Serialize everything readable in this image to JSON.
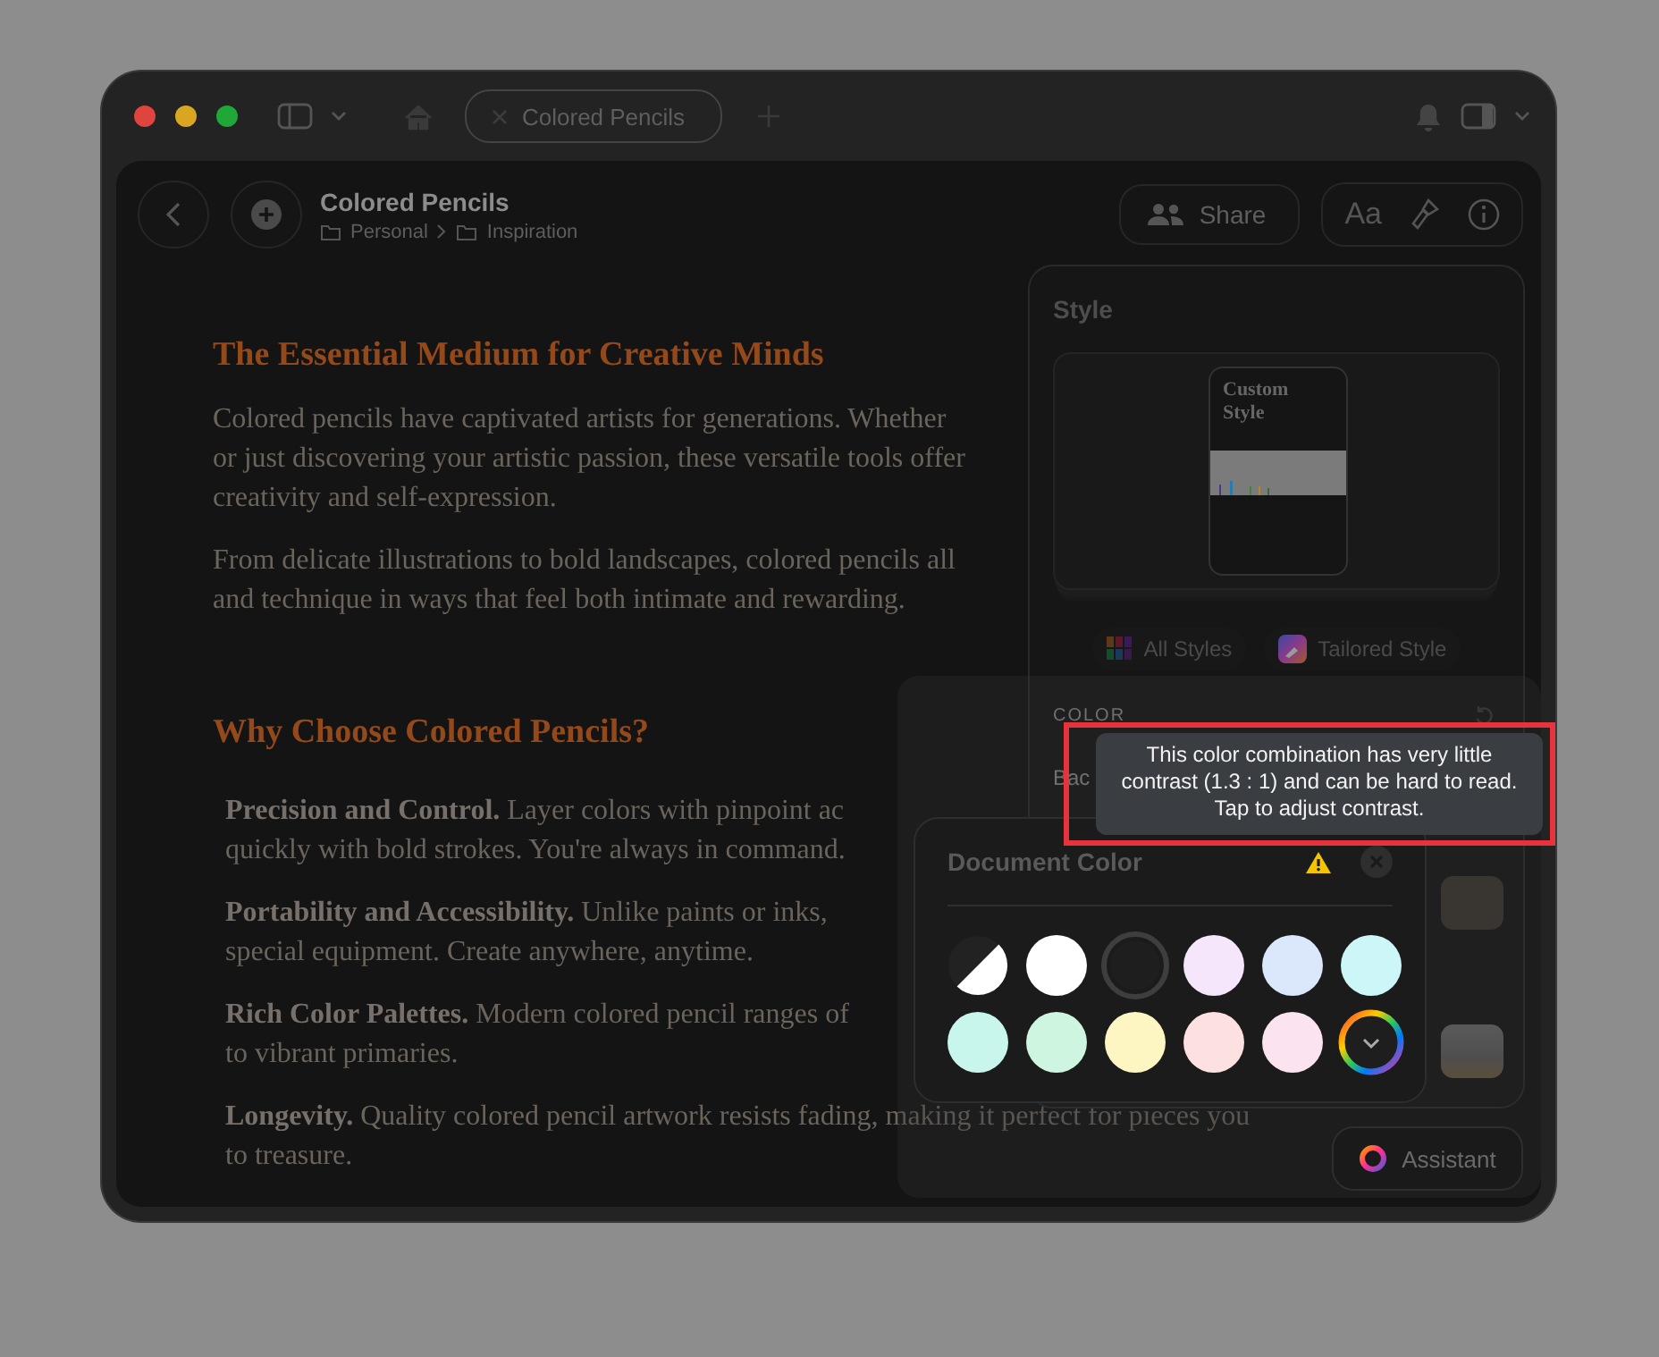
{
  "window": {
    "tab_title": "Colored Pencils"
  },
  "header": {
    "title": "Colored Pencils",
    "breadcrumb": [
      "Personal",
      "Inspiration"
    ],
    "share": "Share",
    "font_button": "Aa"
  },
  "document": {
    "sections": [
      {
        "heading": "The Essential Medium for Creative Minds",
        "paragraphs": [
          {
            "lines": [
              "Colored pencils have captivated artists for generations. Whether",
              "or just discovering your artistic passion, these versatile tools offer",
              "creativity and self-expression."
            ]
          },
          {
            "lines": [
              "From delicate illustrations to bold landscapes, colored pencils all",
              "and technique in ways that feel both intimate and rewarding."
            ]
          }
        ]
      },
      {
        "heading": "Why Choose Colored Pencils?",
        "items": [
          {
            "lines": [
              "**Precision and Control.** Layer colors with pinpoint ac",
              "quickly with bold strokes. You're always in command."
            ]
          },
          {
            "lines": [
              "**Portability and Accessibility.** Unlike paints or inks,",
              "special equipment. Create anywhere, anytime."
            ]
          },
          {
            "lines": [
              "**Rich Color Palettes.** Modern colored pencil ranges of",
              "to vibrant primaries."
            ]
          },
          {
            "lines": [
              "**Longevity.** Quality colored pencil artwork resists fading, making it perfect for pieces you",
              "to treasure."
            ]
          }
        ]
      }
    ]
  },
  "style_panel": {
    "title": "Style",
    "preview_label": "Custom Style",
    "buttons": [
      "All Styles",
      "Tailored Style"
    ],
    "color_label": "COLOR",
    "row_label": "Bac"
  },
  "document_color": {
    "title": "Document Color",
    "swatches": [
      {
        "kind": "auto",
        "selected": false
      },
      {
        "kind": "color",
        "color": "#ffffff",
        "selected": false
      },
      {
        "kind": "color",
        "color": "#1e1e1e",
        "selected": true
      },
      {
        "kind": "color",
        "color": "#f5e6fb",
        "selected": false
      },
      {
        "kind": "color",
        "color": "#dbe8fb",
        "selected": false
      },
      {
        "kind": "color",
        "color": "#cdf6f8",
        "selected": false
      },
      {
        "kind": "color",
        "color": "#c9f6ec",
        "selected": false
      },
      {
        "kind": "color",
        "color": "#cdf5df",
        "selected": false
      },
      {
        "kind": "color",
        "color": "#fdf6c3",
        "selected": false
      },
      {
        "kind": "color",
        "color": "#fde0e0",
        "selected": false
      },
      {
        "kind": "color",
        "color": "#fbe3ef",
        "selected": false
      },
      {
        "kind": "custom",
        "selected": false
      }
    ]
  },
  "tooltip": {
    "lines": [
      "This color combination has very little",
      "contrast (1.3 : 1) and can be hard to read.",
      "Tap to adjust contrast."
    ]
  },
  "assistant": {
    "label": "Assistant"
  }
}
